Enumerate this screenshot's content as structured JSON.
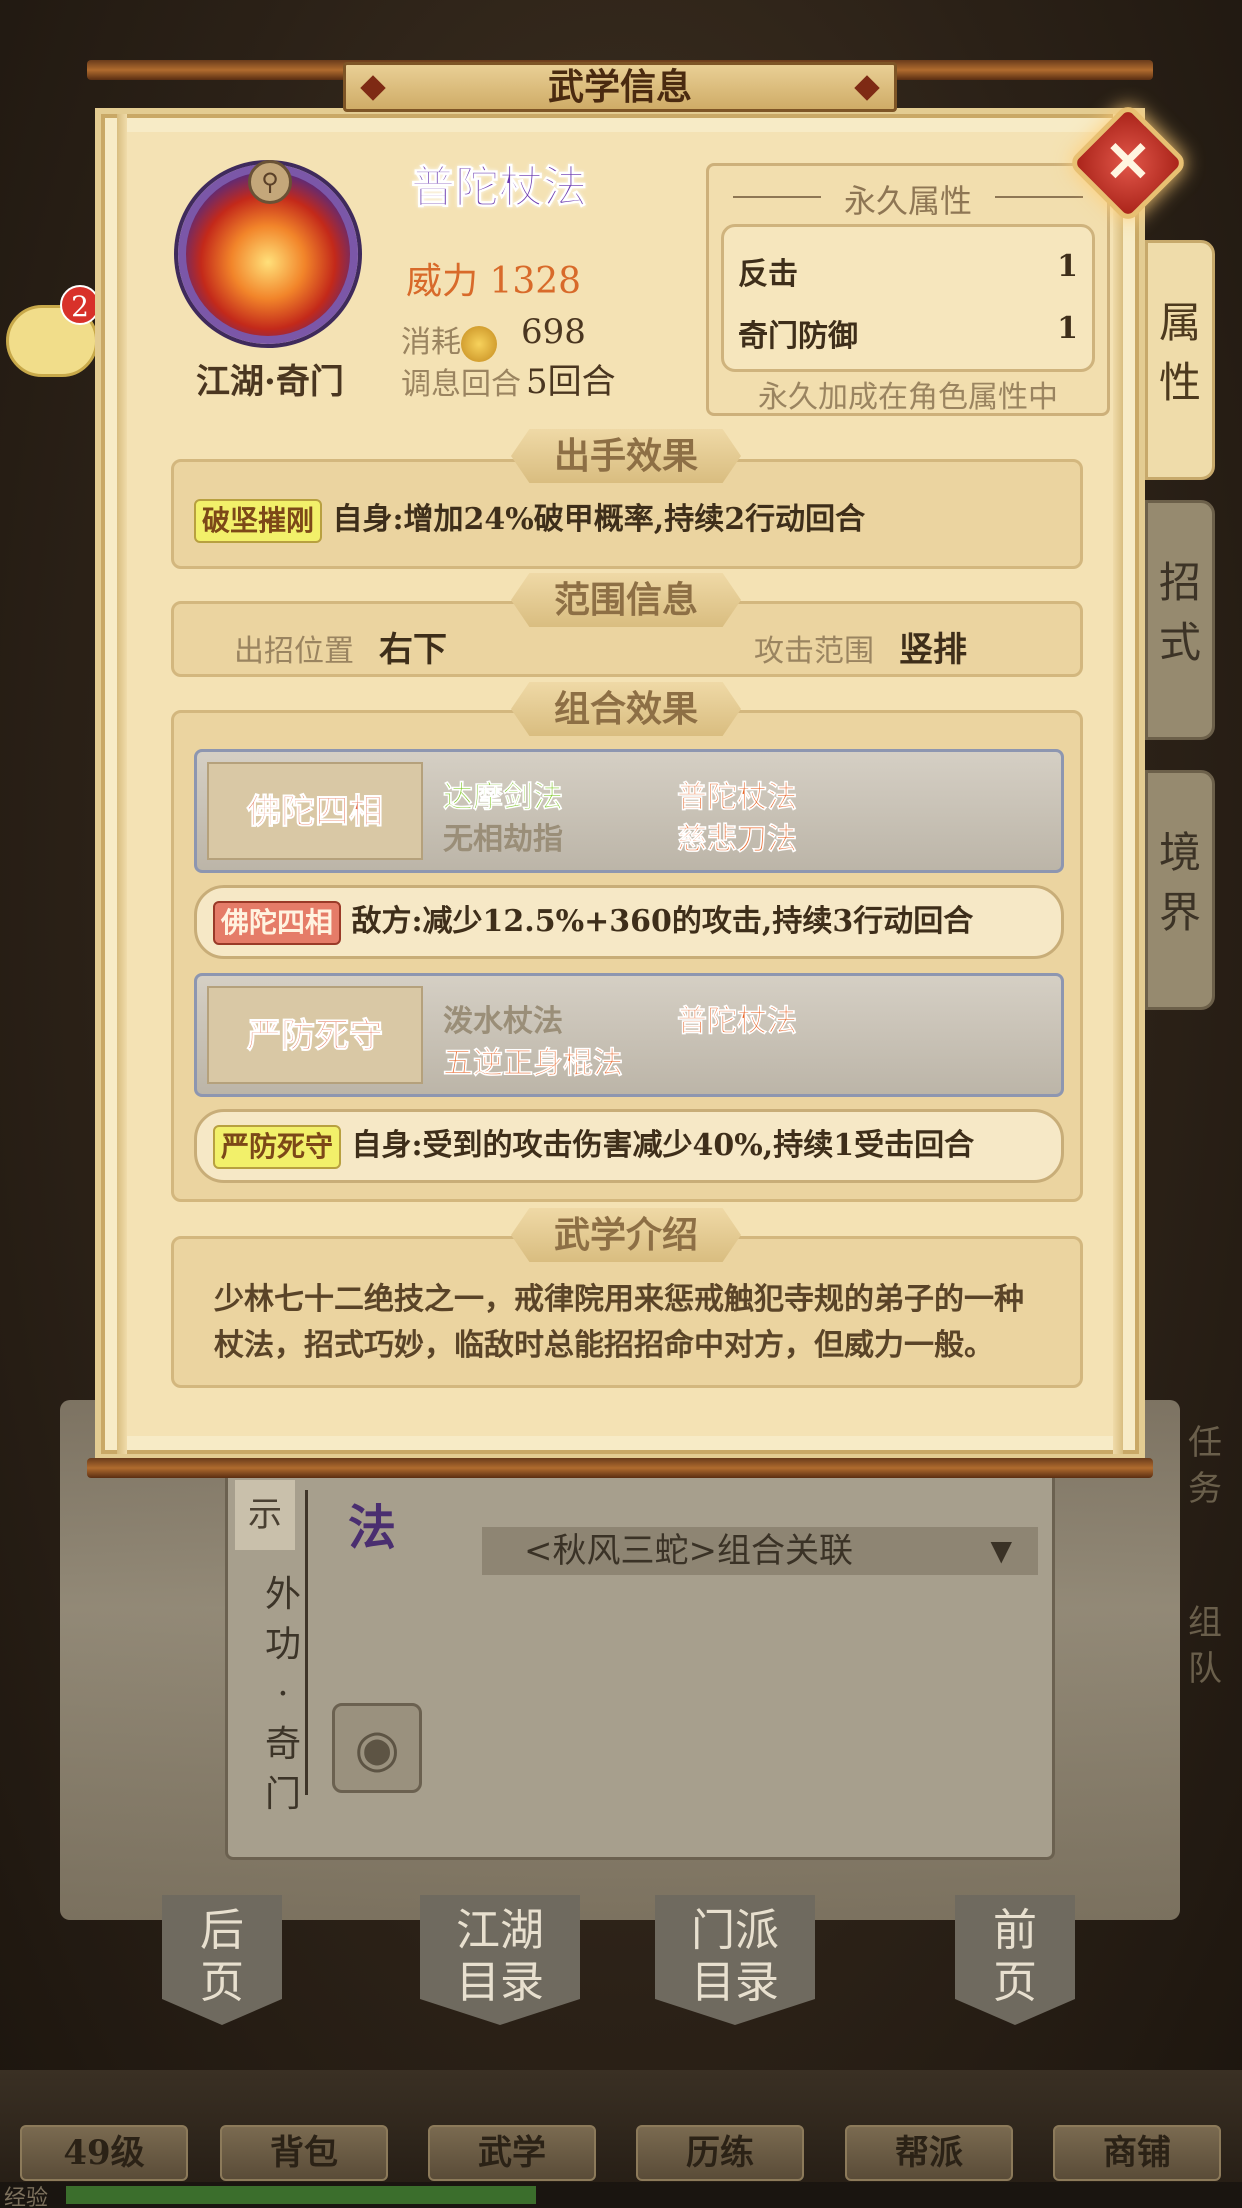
{
  "dialog": {
    "title": "武学信息",
    "close_icon": "close-x-icon"
  },
  "tabs": [
    {
      "label": "属性",
      "active": true
    },
    {
      "label": "招式",
      "active": false
    },
    {
      "label": "境界",
      "active": false
    }
  ],
  "skill": {
    "name": "普陀杖法",
    "category": "江湖·奇门",
    "power_label": "威力",
    "power_value": "1328",
    "cost_label": "消耗",
    "cost_value": "698",
    "rest_label": "调息回合",
    "rest_value": "5回合"
  },
  "permanent": {
    "title": "永久属性",
    "rows": [
      {
        "name": "反击",
        "value": "1"
      },
      {
        "name": "奇门防御",
        "value": "1"
      }
    ],
    "footer": "永久加成在角色属性中"
  },
  "attack_effect": {
    "header": "出手效果",
    "tag": "破坚摧刚",
    "text": "自身:增加24%破甲概率,持续2行动回合"
  },
  "range": {
    "header": "范围信息",
    "position_label": "出招位置",
    "position_value": "右下",
    "area_label": "攻击范围",
    "area_value": "竖排"
  },
  "combos": {
    "header": "组合效果",
    "items": [
      {
        "name": "佛陀四相",
        "members": [
          {
            "label": "达摩剑法",
            "state": "active"
          },
          {
            "label": "普陀杖法",
            "state": "owned"
          },
          {
            "label": "无相劫指",
            "state": "missing"
          },
          {
            "label": "慈悲刀法",
            "state": "owned"
          }
        ],
        "effect_tag": "佛陀四相",
        "effect_text": "敌方:减少12.5%+360的攻击,持续3行动回合"
      },
      {
        "name": "严防死守",
        "members": [
          {
            "label": "泼水杖法",
            "state": "missing"
          },
          {
            "label": "普陀杖法",
            "state": "owned"
          },
          {
            "label": "五逆正身棍法",
            "state": "owned"
          }
        ],
        "effect_tag": "严防死守",
        "effect_text": "自身:受到的攻击伤害减少40%,持续1受击回合"
      }
    ]
  },
  "intro": {
    "header": "武学介绍",
    "text": "少林七十二绝技之一，戒律院用来惩戒触犯寺规的弟子的一种杖法，招式巧妙，临敌时总能招招命中对方，但威力一般。"
  },
  "background": {
    "chat_badge": "2",
    "side_tag": "示",
    "vert_text": [
      "外",
      "功",
      "·",
      "奇",
      "门"
    ],
    "skill_fragment": "法",
    "dropdown": "<秋风三蛇>组合关联",
    "page_buttons": [
      "后页",
      "江湖目录",
      "门派目录",
      "前页"
    ],
    "right_side": [
      "任务",
      "组队"
    ],
    "nav": [
      "49级",
      "背包",
      "武学",
      "历练",
      "帮派",
      "商铺"
    ],
    "xp_label": "经验",
    "xp_progress": 0.4
  }
}
